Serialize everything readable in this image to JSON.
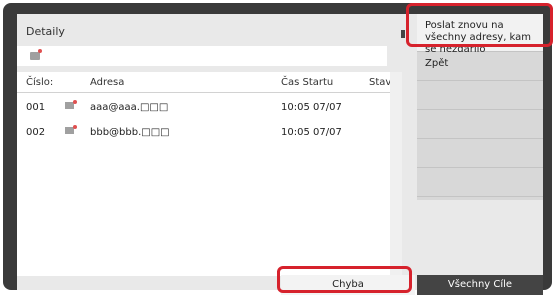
{
  "header": {
    "title": "Detaily"
  },
  "table": {
    "columns": [
      "Číslo:",
      "Adresa",
      "Čas Startu",
      "Stav"
    ],
    "rows": [
      {
        "number": "001",
        "address": "aaa@aaa.□□□",
        "start_time": "10:05 07/07",
        "status": ""
      },
      {
        "number": "002",
        "address": "bbb@bbb.□□□",
        "start_time": "10:05 07/07",
        "status": ""
      }
    ]
  },
  "menu": {
    "resend": "Poslat znovu na všechny adresy, kam se nezdařilo",
    "back": "Zpět"
  },
  "bottom": {
    "error_label": "Chyba",
    "all_label": "Všechny Cíle"
  },
  "colors": {
    "highlight": "#d6222c",
    "frame": "#3a3a3a"
  }
}
